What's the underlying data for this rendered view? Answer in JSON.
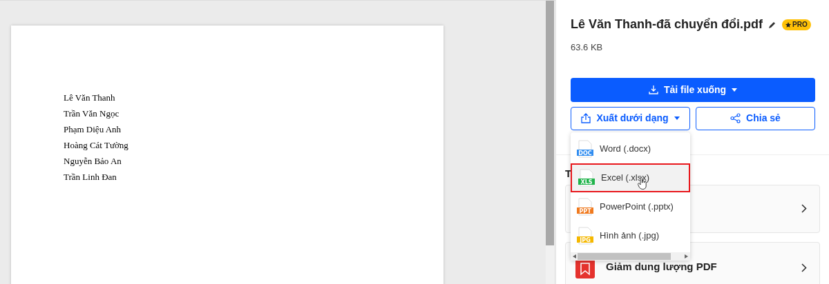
{
  "document": {
    "lines": [
      "Lê Văn Thanh",
      "Trần Văn Ngọc",
      "Phạm Diệu Anh",
      "Hoàng Cát Tường",
      "Nguyễn Bảo An",
      "Trần Linh Đan"
    ]
  },
  "file": {
    "name": "Lê Văn Thanh-đã chuyển đổi.pdf",
    "badge": "PRO",
    "size": "63.6 KB"
  },
  "download_button": {
    "label": "Tải file xuống"
  },
  "export_button": {
    "label": "Xuất dưới dạng"
  },
  "share_button": {
    "label": "Chia sẻ"
  },
  "export_menu": [
    {
      "label": "Word (.docx)",
      "tag": "DOC",
      "color": "#2f8cf0",
      "selected": false
    },
    {
      "label": "Excel (.xlsx)",
      "tag": "XLS",
      "color": "#1fb34a",
      "selected": true
    },
    {
      "label": "PowerPoint (.pptx)",
      "tag": "PPT",
      "color": "#f07a1f",
      "selected": false
    },
    {
      "label": "Hình ảnh (.jpg)",
      "tag": "JPG",
      "color": "#f5b800",
      "selected": false
    }
  ],
  "tools_heading": "T",
  "tools": [
    {
      "kind": "blank"
    },
    {
      "label": "Giảm dung lượng PDF",
      "kind": "compress"
    }
  ]
}
